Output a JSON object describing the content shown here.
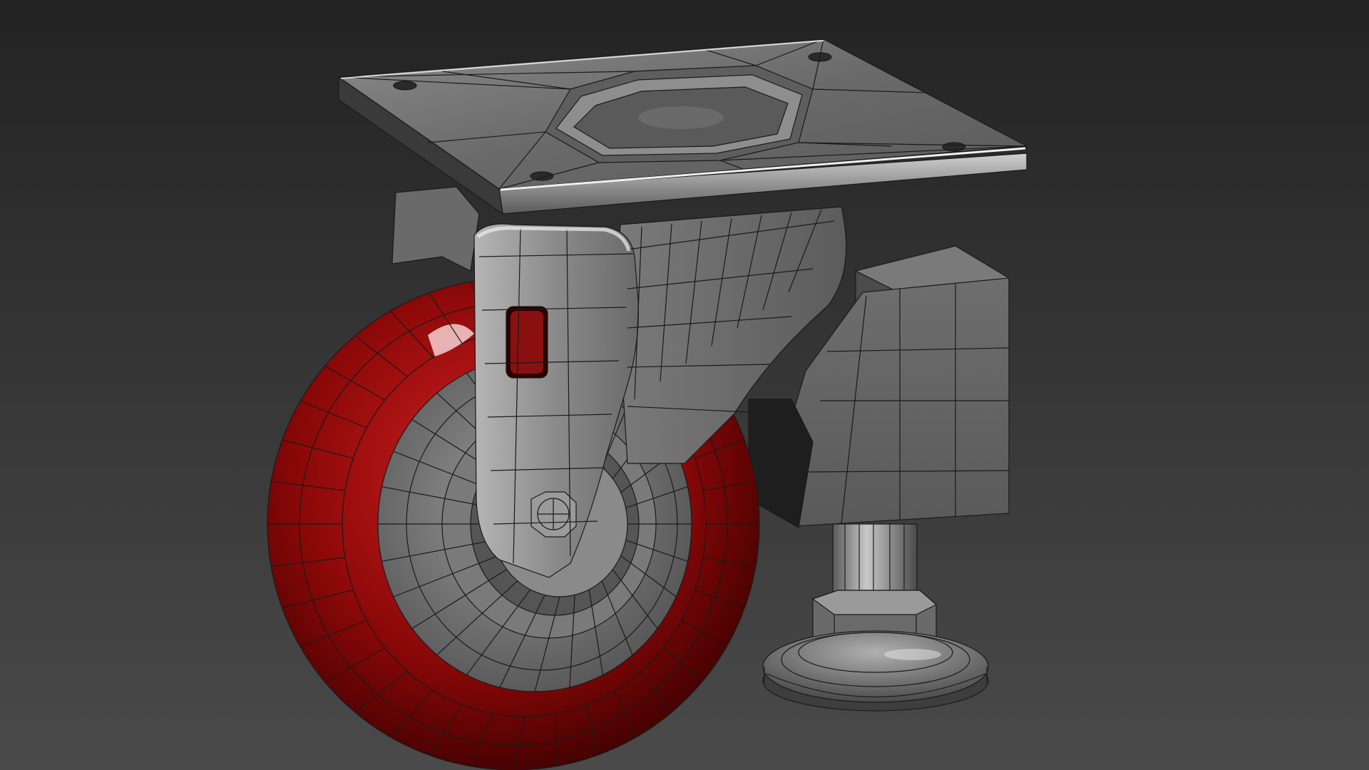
{
  "scene": {
    "subject": "caster-wheel-with-leveling-foot",
    "render_mode": "wireframe-on-shaded",
    "colors": {
      "background_top": "#232323",
      "background_bottom": "#4a4a4a",
      "metal_light": "#9a9a9a",
      "metal_mid": "#6e6e6e",
      "metal_dark": "#3c3c3c",
      "wire": "#1a1a1a",
      "wheel_red": "#b01010",
      "wheel_red_dark": "#4a0000",
      "highlight": "#f2f2f2"
    }
  }
}
